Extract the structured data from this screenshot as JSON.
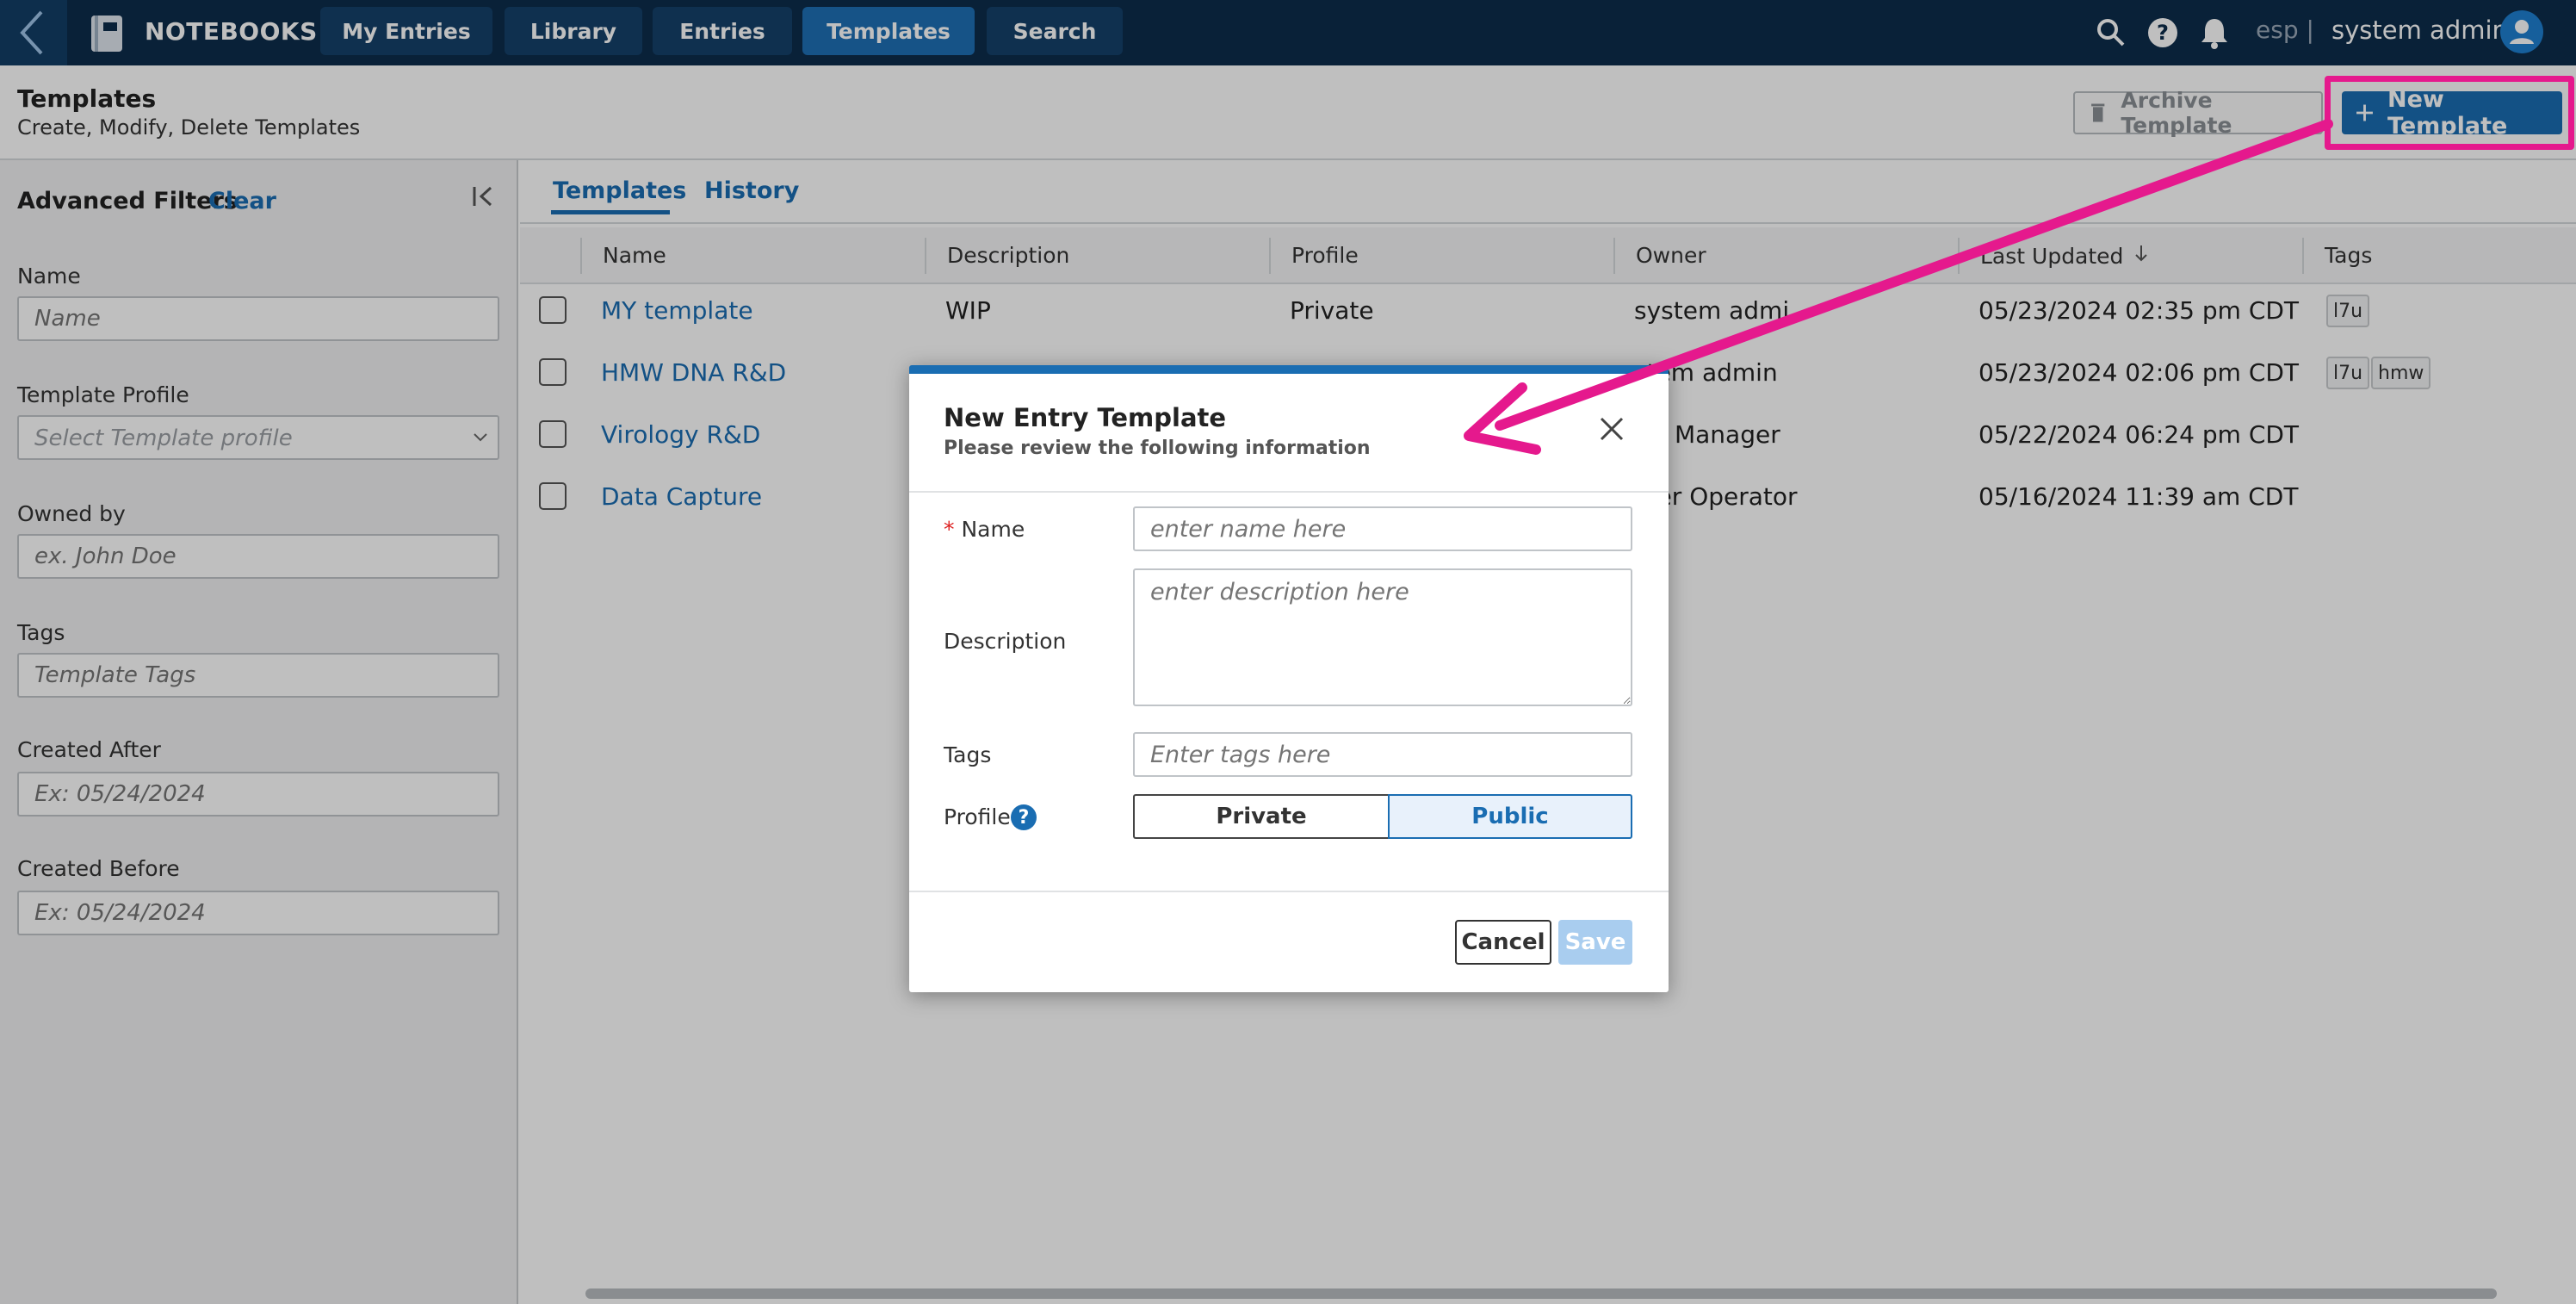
{
  "topnav": {
    "app_title": "NOTEBOOKS",
    "tabs": [
      {
        "label": "My Entries",
        "active": false
      },
      {
        "label": "Library",
        "active": false
      },
      {
        "label": "Entries",
        "active": false
      },
      {
        "label": "Templates",
        "active": true
      },
      {
        "label": "Search",
        "active": false
      }
    ],
    "lang": "esp |",
    "user_name": "system admin",
    "icons": [
      "back-chevron-icon",
      "notebook-logo-icon",
      "search-icon",
      "help-icon",
      "bell-icon",
      "user-avatar-icon"
    ]
  },
  "page_header": {
    "title": "Templates",
    "subtitle": "Create, Modify, Delete Templates",
    "archive_label": "Archive Template",
    "new_label": "New Template"
  },
  "filters": {
    "title": "Advanced Filters",
    "clear": "Clear",
    "fields": [
      {
        "label": "Name",
        "placeholder": "Name"
      },
      {
        "label": "Template Profile",
        "placeholder": "Select Template profile"
      },
      {
        "label": "Owned by",
        "placeholder": "ex. John Doe"
      },
      {
        "label": "Tags",
        "placeholder": "Template Tags"
      },
      {
        "label": "Created After",
        "placeholder": "Ex: 05/24/2024"
      },
      {
        "label": "Created Before",
        "placeholder": "Ex: 05/24/2024"
      }
    ]
  },
  "subtabs": [
    "Templates",
    "History"
  ],
  "table": {
    "columns": [
      "Name",
      "Description",
      "Profile",
      "Owner",
      "Last Updated",
      "Tags"
    ],
    "sort_column": "Last Updated",
    "sort_direction": "descending",
    "rows": [
      {
        "name": "MY template",
        "description": "WIP",
        "profile": "Private",
        "owner": "system admi",
        "updated": "05/23/2024 02:35 pm CDT",
        "tags": [
          "l7u"
        ]
      },
      {
        "name": "HMW DNA R&D",
        "description": "",
        "profile": "",
        "owner": "stem admin",
        "updated": "05/23/2024 02:06 pm CDT",
        "tags": [
          "l7u",
          "hmw"
        ]
      },
      {
        "name": "Virology R&D",
        "description": "",
        "profile": "",
        "owner": "ry Manager",
        "updated": "05/22/2024 06:24 pm CDT",
        "tags": []
      },
      {
        "name": "Data Capture",
        "description": "",
        "profile": "",
        "owner": "ver Operator",
        "updated": "05/16/2024 11:39 am CDT",
        "tags": []
      }
    ]
  },
  "modal": {
    "title": "New Entry Template",
    "subtitle": "Please review the following information",
    "required_mark": "*",
    "name_label": "Name",
    "name_placeholder": "enter name here",
    "description_label": "Description",
    "description_placeholder": "enter description here",
    "tags_label": "Tags",
    "tags_placeholder": "Enter tags here",
    "profile_label": "Profile",
    "profile_help": "?",
    "profile_options": [
      "Private",
      "Public"
    ],
    "profile_selected": "Public",
    "cancel_label": "Cancel",
    "save_label": "Save"
  },
  "annotation": {
    "highlight_color": "#e5198d"
  },
  "colors": {
    "nav_bg": "#0c2c4b",
    "accent": "#1a6db2",
    "active_tab": "#1e6fb4"
  }
}
